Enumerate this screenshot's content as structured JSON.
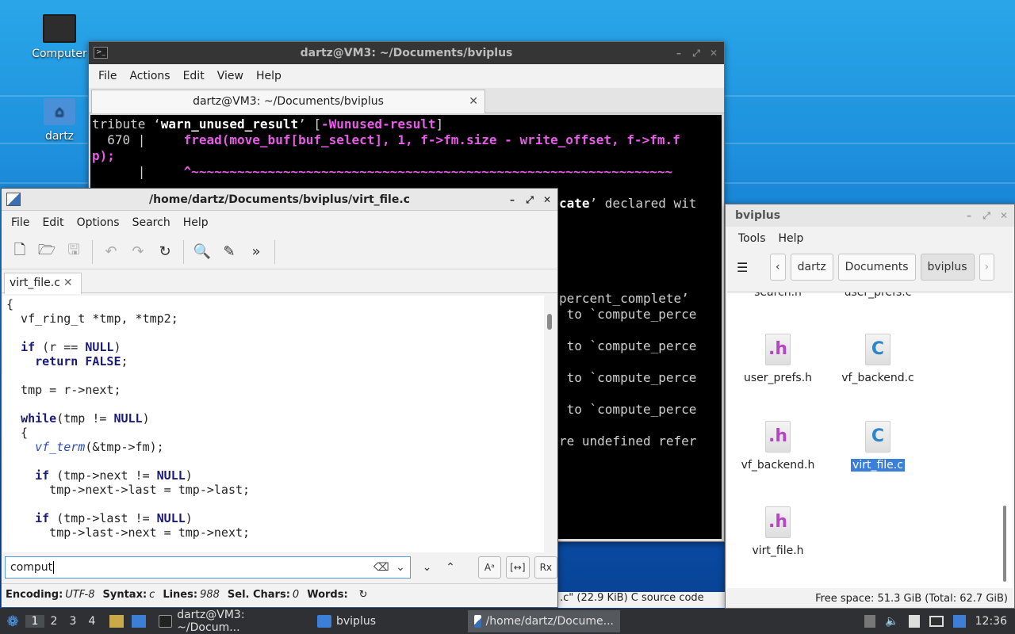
{
  "desktop": {
    "icons": [
      {
        "label": "Computer"
      },
      {
        "label": "dartz"
      }
    ]
  },
  "terminal": {
    "title": "dartz@VM3: ~/Documents/bviplus",
    "menu": [
      "File",
      "Actions",
      "Edit",
      "View",
      "Help"
    ],
    "tab_label": "dartz@VM3: ~/Documents/bviplus",
    "lines": {
      "l1a": "tribute ‘",
      "l1b": "warn_unused_result",
      "l1c": "’ [",
      "l1d": "-Wunused-result",
      "l1e": "]",
      "l2a": "  670 |     ",
      "l2b": "fread(move_buf[buf_select], 1, f->fm.size - write_offset, f->fm.f",
      "l3": "p);",
      "l4a": "      |     ",
      "l4b": "^~~~~~~~~~~~~~~~~~~~~~~~~~~~~~~~~~~~~~~~~~~~~~~~~~~~~~~~~~~~~~~~",
      "r1a": "cate",
      "r1b": "’ declared wit",
      "r2": "percent_complete’",
      "r3": " to `compute_perce",
      "r4": " to `compute_perce",
      "r5": " to `compute_perce",
      "r6": " to `compute_perce",
      "r7": "re undefined refer"
    },
    "bottom_text": ".c\" (22.9 KiB) C source code"
  },
  "editor": {
    "title": "/home/dartz/Documents/bviplus/virt_file.c",
    "menu": [
      "File",
      "Edit",
      "Options",
      "Search",
      "Help"
    ],
    "tab_label": "virt_file.c",
    "code": {
      "c1": "{",
      "c2": "  vf_ring_t *tmp, *tmp2;",
      "c3a": "  ",
      "c3b": "if",
      "c3c": " (r == ",
      "c3d": "NULL",
      "c3e": ")",
      "c4a": "    ",
      "c4b": "return",
      "c4c": " ",
      "c4d": "FALSE",
      "c4e": ";",
      "c5": "  tmp = r->next;",
      "c6a": "  ",
      "c6b": "while",
      "c6c": "(tmp != ",
      "c6d": "NULL",
      "c6e": ")",
      "c7": "  {",
      "c8a": "    ",
      "c8b": "vf_term",
      "c8c": "(&tmp->fm);",
      "c9a": "    ",
      "c9b": "if",
      "c9c": " (tmp->next != ",
      "c9d": "NULL",
      "c9e": ")",
      "c10": "      tmp->next->last = tmp->last;",
      "c11a": "    ",
      "c11b": "if",
      "c11c": " (tmp->last != ",
      "c11d": "NULL",
      "c11e": ")",
      "c12": "      tmp->last->next = tmp->next;"
    },
    "search": {
      "value": "comput"
    },
    "status": {
      "encoding_label": "Encoding:",
      "encoding": "UTF-8",
      "syntax_label": "Syntax:",
      "syntax": "c",
      "lines_label": "Lines:",
      "lines": "988",
      "sel_label": "Sel. Chars:",
      "sel": "0",
      "words_label": "Words:"
    }
  },
  "filemanager": {
    "title": "bviplus",
    "menu": [
      "Tools",
      "Help"
    ],
    "path": [
      "dartz",
      "Documents",
      "bviplus"
    ],
    "partial_top": [
      "search.h",
      "user_prefs.c"
    ],
    "files": [
      {
        "name": "user_prefs.h",
        "type": "h"
      },
      {
        "name": "vf_backend.c",
        "type": "c"
      },
      {
        "name": "vf_backend.h",
        "type": "h"
      },
      {
        "name": "virt_file.c",
        "type": "c"
      },
      {
        "name": "virt_file.h",
        "type": "h"
      }
    ],
    "status": "Free space: 51.3 GiB (Total: 62.7 GiB)"
  },
  "taskbar": {
    "workspaces": [
      "1",
      "2",
      "3",
      "4"
    ],
    "tasks": [
      {
        "label": "dartz@VM3: ~/Docum..."
      },
      {
        "label": "bviplus"
      },
      {
        "label": "/home/dartz/Docume..."
      }
    ],
    "clock": "12:36"
  }
}
